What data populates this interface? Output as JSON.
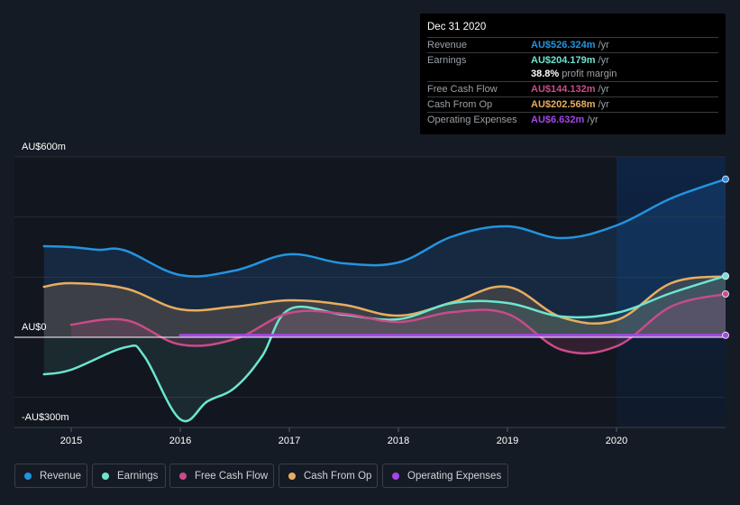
{
  "tooltip": {
    "date": "Dec 31 2020",
    "rows": [
      {
        "label": "Revenue",
        "value": "AU$526.324m",
        "unit": " /yr",
        "color": "#2394df"
      },
      {
        "label": "Earnings",
        "value": "AU$204.179m",
        "unit": " /yr",
        "color": "#6ce5cf"
      },
      {
        "label": "",
        "value": "38.8%",
        "unit": " profit margin",
        "color": "#ffffff"
      },
      {
        "label": "Free Cash Flow",
        "value": "AU$144.132m",
        "unit": " /yr",
        "color": "#c94b8a"
      },
      {
        "label": "Cash From Op",
        "value": "AU$202.568m",
        "unit": " /yr",
        "color": "#e9ad5f"
      },
      {
        "label": "Operating Expenses",
        "value": "AU$6.632m",
        "unit": " /yr",
        "color": "#a546e8"
      }
    ]
  },
  "legend": [
    {
      "label": "Revenue",
      "color": "#2394df"
    },
    {
      "label": "Earnings",
      "color": "#6ce5cf"
    },
    {
      "label": "Free Cash Flow",
      "color": "#c94b8a"
    },
    {
      "label": "Cash From Op",
      "color": "#e9ad5f"
    },
    {
      "label": "Operating Expenses",
      "color": "#a546e8"
    }
  ],
  "chart_data": {
    "type": "line",
    "title": "",
    "xlabel": "",
    "ylabel": "",
    "y_tick_labels": [
      "AU$600m",
      "AU$0",
      "-AU$300m"
    ],
    "y_ticks": [
      600,
      0,
      -300
    ],
    "ylim": [
      -300,
      600
    ],
    "xlim": [
      2014.75,
      2021.0
    ],
    "x_tick_labels": [
      "2015",
      "2016",
      "2017",
      "2018",
      "2019",
      "2020"
    ],
    "x_ticks": [
      2015,
      2016,
      2017,
      2018,
      2019,
      2020
    ],
    "grid": true,
    "highlight_region": [
      2020.0,
      2021.0
    ],
    "legend_position": "bottom-left",
    "series": [
      {
        "name": "Revenue",
        "color": "#2394df",
        "x": [
          2014.75,
          2015.0,
          2015.25,
          2015.5,
          2016.0,
          2016.5,
          2017.0,
          2017.5,
          2018.0,
          2018.5,
          2019.0,
          2019.5,
          2020.0,
          2020.5,
          2021.0
        ],
        "values": [
          303,
          300,
          291,
          288,
          207,
          222,
          276,
          246,
          249,
          336,
          369,
          330,
          372,
          462,
          526
        ]
      },
      {
        "name": "Earnings",
        "color": "#6ce5cf",
        "x": [
          2014.75,
          2015.0,
          2015.5,
          2015.67,
          2016.0,
          2016.25,
          2016.5,
          2016.75,
          2017.0,
          2017.5,
          2018.0,
          2018.5,
          2019.0,
          2019.5,
          2020.0,
          2020.5,
          2021.0
        ],
        "values": [
          -123,
          -108,
          -33,
          -63,
          -273,
          -213,
          -168,
          -63,
          93,
          75,
          60,
          114,
          114,
          69,
          81,
          147,
          204
        ]
      },
      {
        "name": "Free Cash Flow",
        "color": "#c94b8a",
        "x": [
          2015.0,
          2015.5,
          2016.0,
          2016.5,
          2017.0,
          2017.5,
          2018.0,
          2018.5,
          2019.0,
          2019.5,
          2020.0,
          2020.5,
          2021.0
        ],
        "values": [
          42,
          57,
          -24,
          -6,
          81,
          78,
          51,
          84,
          78,
          -42,
          -30,
          102,
          144
        ]
      },
      {
        "name": "Cash From Op",
        "color": "#e9ad5f",
        "x": [
          2014.75,
          2015.0,
          2015.5,
          2016.0,
          2016.5,
          2017.0,
          2017.5,
          2018.0,
          2018.5,
          2019.0,
          2019.5,
          2020.0,
          2020.5,
          2021.0
        ],
        "values": [
          168,
          180,
          162,
          93,
          102,
          123,
          108,
          72,
          117,
          168,
          66,
          57,
          180,
          203
        ]
      },
      {
        "name": "Operating Expenses",
        "color": "#a546e8",
        "x": [
          2016.0,
          2017.0,
          2018.0,
          2019.0,
          2020.0,
          2021.0
        ],
        "values": [
          6.6,
          6.6,
          6.6,
          6.6,
          6.6,
          6.6
        ]
      }
    ]
  }
}
